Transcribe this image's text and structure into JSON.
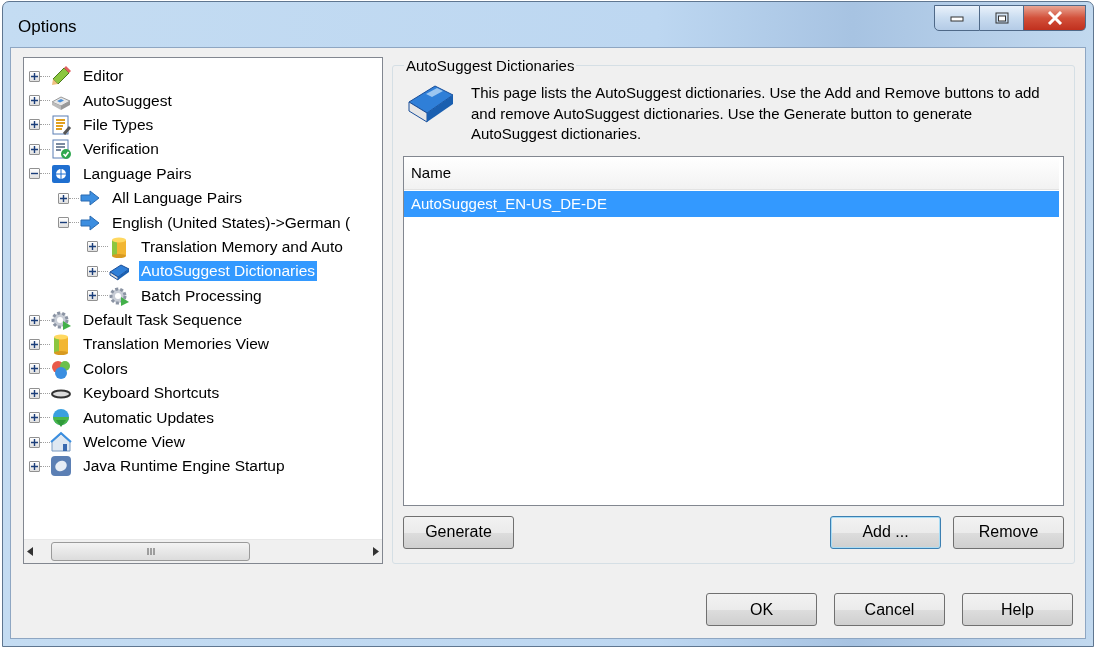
{
  "window": {
    "title": "Options"
  },
  "tree": {
    "items": [
      {
        "label": "Editor",
        "kind": "pencil",
        "expanded": false,
        "selected": false
      },
      {
        "label": "AutoSuggest",
        "kind": "keycap",
        "expanded": false,
        "selected": false
      },
      {
        "label": "File Types",
        "kind": "document",
        "expanded": false,
        "selected": false
      },
      {
        "label": "Verification",
        "kind": "checklist",
        "expanded": false,
        "selected": false
      },
      {
        "label": "Language Pairs",
        "kind": "globe",
        "expanded": true,
        "selected": false,
        "children": [
          {
            "label": "All Language Pairs",
            "kind": "arrow",
            "expanded": false,
            "selected": false
          },
          {
            "label": "English (United States)->German (",
            "kind": "arrow",
            "expanded": true,
            "selected": false,
            "children": [
              {
                "label": "Translation Memory and Auto",
                "kind": "database",
                "expanded": false,
                "selected": false
              },
              {
                "label": "AutoSuggest Dictionaries",
                "kind": "book",
                "expanded": false,
                "selected": true
              },
              {
                "label": "Batch Processing",
                "kind": "gear",
                "expanded": false,
                "selected": false
              }
            ]
          }
        ]
      },
      {
        "label": "Default Task Sequence",
        "kind": "gear",
        "expanded": false,
        "selected": false
      },
      {
        "label": "Translation Memories View",
        "kind": "database",
        "expanded": false,
        "selected": false
      },
      {
        "label": "Colors",
        "kind": "circles",
        "expanded": false,
        "selected": false
      },
      {
        "label": "Keyboard Shortcuts",
        "kind": "key",
        "expanded": false,
        "selected": false
      },
      {
        "label": "Automatic Updates",
        "kind": "update",
        "expanded": false,
        "selected": false
      },
      {
        "label": "Welcome View",
        "kind": "house",
        "expanded": false,
        "selected": false
      },
      {
        "label": "Java Runtime Engine Startup",
        "kind": "leaf",
        "expanded": false,
        "selected": false
      }
    ]
  },
  "panel": {
    "title": "AutoSuggest Dictionaries",
    "description": "This page lists the AutoSuggest dictionaries. Use the Add and Remove buttons to add and remove AutoSuggest dictionaries. Use the Generate button to generate AutoSuggest dictionaries.",
    "columns": [
      "Name"
    ],
    "rows": [
      {
        "name": "AutoSuggest_EN-US_DE-DE",
        "selected": true
      }
    ],
    "buttons": [
      {
        "label": "Generate",
        "focused": false
      },
      {
        "label": "Add ...",
        "focused": true
      },
      {
        "label": "Remove",
        "focused": false
      }
    ]
  },
  "buttons": [
    {
      "label": "OK"
    },
    {
      "label": "Cancel"
    },
    {
      "label": "Help"
    }
  ]
}
